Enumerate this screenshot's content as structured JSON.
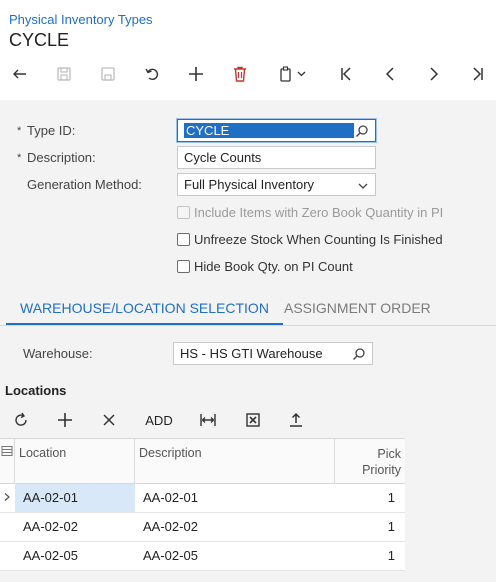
{
  "header": {
    "breadcrumb": "Physical Inventory Types",
    "title": "CYCLE"
  },
  "toolbar": {
    "icons": [
      "back-icon",
      "save-and-close-icon",
      "save-icon",
      "undo-icon",
      "add-icon",
      "delete-icon",
      "copy-paste-icon",
      "first-record-icon",
      "previous-record-icon",
      "next-record-icon",
      "last-record-icon"
    ]
  },
  "form": {
    "type_id_label": "Type ID:",
    "type_id_value": "CYCLE",
    "description_label": "Description:",
    "description_value": "Cycle Counts",
    "generation_method_label": "Generation Method:",
    "generation_method_value": "Full Physical Inventory",
    "required_marker": "*",
    "checkbox_zero_qty": "Include Items with Zero Book Quantity in PI",
    "checkbox_unfreeze": "Unfreeze Stock When Counting Is Finished",
    "checkbox_hide_qty": "Hide Book Qty. on PI Count"
  },
  "tabs": {
    "warehouse_tab": "WAREHOUSE/LOCATION SELECTION",
    "assignment_tab": "ASSIGNMENT ORDER"
  },
  "warehouse": {
    "label": "Warehouse:",
    "value": "HS - HS GTI Warehouse"
  },
  "locations": {
    "title": "Locations",
    "add_text_button": "ADD",
    "columns": {
      "location": "Location",
      "description": "Description",
      "pick_priority": "Pick Priority"
    },
    "rows": [
      {
        "location": "AA-02-01",
        "description": "AA-02-01",
        "pick_priority": "1"
      },
      {
        "location": "AA-02-02",
        "description": "AA-02-02",
        "pick_priority": "1"
      },
      {
        "location": "AA-02-05",
        "description": "AA-02-05",
        "pick_priority": "1"
      }
    ]
  },
  "colors": {
    "accent": "#1f6fc5",
    "background": "#f3f3f3",
    "selected_row": "#d8e8f8"
  }
}
